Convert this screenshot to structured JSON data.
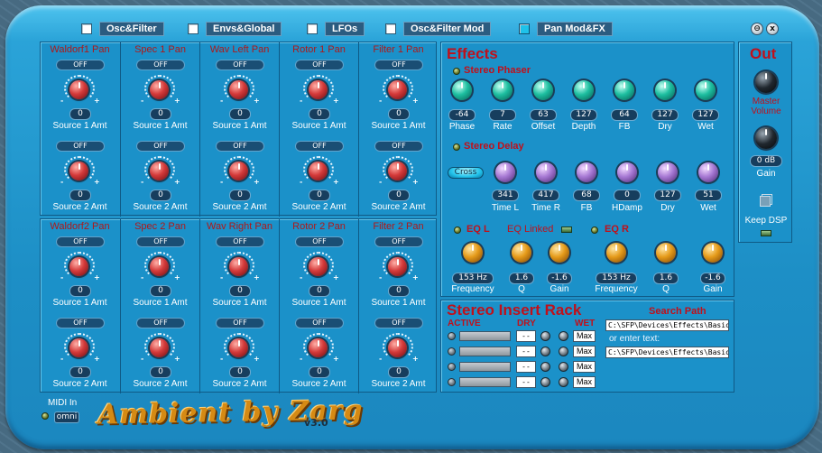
{
  "tabs": [
    {
      "label": "Osc&Filter",
      "active": false
    },
    {
      "label": "Envs&Global",
      "active": false
    },
    {
      "label": "LFOs",
      "active": false
    },
    {
      "label": "Osc&Filter Mod",
      "active": false
    },
    {
      "label": "Pan Mod&FX",
      "active": true
    }
  ],
  "window": {
    "minimize": "⊖",
    "close": "x"
  },
  "pan_rows": [
    {
      "cells": [
        {
          "title": "Waldorf1 Pan",
          "btn1": "OFF",
          "val1": "0",
          "lbl1": "Source 1 Amt",
          "btn2": "OFF",
          "val2": "0",
          "lbl2": "Source 2 Amt"
        },
        {
          "title": "Spec 1 Pan",
          "btn1": "OFF",
          "val1": "0",
          "lbl1": "Source 1 Amt",
          "btn2": "OFF",
          "val2": "0",
          "lbl2": "Source 2 Amt"
        },
        {
          "title": "Wav Left Pan",
          "btn1": "OFF",
          "val1": "0",
          "lbl1": "Source 1 Amt",
          "btn2": "OFF",
          "val2": "0",
          "lbl2": "Source 2 Amt"
        },
        {
          "title": "Rotor 1 Pan",
          "btn1": "OFF",
          "val1": "0",
          "lbl1": "Source 1 Amt",
          "btn2": "OFF",
          "val2": "0",
          "lbl2": "Source 2 Amt"
        },
        {
          "title": "Filter 1 Pan",
          "btn1": "OFF",
          "val1": "0",
          "lbl1": "Source 1 Amt",
          "btn2": "OFF",
          "val2": "0",
          "lbl2": "Source 2 Amt"
        }
      ]
    },
    {
      "cells": [
        {
          "title": "Waldorf2 Pan",
          "btn1": "OFF",
          "val1": "0",
          "lbl1": "Source 1 Amt",
          "btn2": "OFF",
          "val2": "0",
          "lbl2": "Source 2 Amt"
        },
        {
          "title": "Spec 2 Pan",
          "btn1": "OFF",
          "val1": "0",
          "lbl1": "Source 1 Amt",
          "btn2": "OFF",
          "val2": "0",
          "lbl2": "Source 2 Amt"
        },
        {
          "title": "Wav Right Pan",
          "btn1": "OFF",
          "val1": "0",
          "lbl1": "Source 1 Amt",
          "btn2": "OFF",
          "val2": "0",
          "lbl2": "Source 2 Amt"
        },
        {
          "title": "Rotor 2 Pan",
          "btn1": "OFF",
          "val1": "0",
          "lbl1": "Source 1 Amt",
          "btn2": "OFF",
          "val2": "0",
          "lbl2": "Source 2 Amt"
        },
        {
          "title": "Filter 2 Pan",
          "btn1": "OFF",
          "val1": "0",
          "lbl1": "Source 1 Amt",
          "btn2": "OFF",
          "val2": "0",
          "lbl2": "Source 2 Amt"
        }
      ]
    }
  ],
  "knob_marks": {
    "minus": "-",
    "plus": "+"
  },
  "effects": {
    "title": "Effects",
    "phaser": {
      "title": "Stereo Phaser",
      "params": [
        {
          "label": "Phase",
          "value": "-64"
        },
        {
          "label": "Rate",
          "value": "7"
        },
        {
          "label": "Offset",
          "value": "63"
        },
        {
          "label": "Depth",
          "value": "127"
        },
        {
          "label": "FB",
          "value": "64"
        },
        {
          "label": "Dry",
          "value": "127"
        },
        {
          "label": "Wet",
          "value": "127"
        }
      ]
    },
    "delay": {
      "title": "Stereo Delay",
      "cross": "Cross",
      "params": [
        {
          "label": "Time L",
          "value": "341"
        },
        {
          "label": "Time R",
          "value": "417"
        },
        {
          "label": "FB",
          "value": "68"
        },
        {
          "label": "HDamp",
          "value": "0"
        },
        {
          "label": "Dry",
          "value": "127"
        },
        {
          "label": "Wet",
          "value": "51"
        }
      ]
    },
    "eq": {
      "left_title": "EQ L",
      "linked": "EQ Linked",
      "right_title": "EQ R",
      "left": [
        {
          "label": "Frequency",
          "value": "153 Hz"
        },
        {
          "label": "Q",
          "value": "1.6"
        },
        {
          "label": "Gain",
          "value": "-1.6"
        }
      ],
      "right": [
        {
          "label": "Frequency",
          "value": "153 Hz"
        },
        {
          "label": "Q",
          "value": "1.6"
        },
        {
          "label": "Gain",
          "value": "-1.6"
        }
      ]
    }
  },
  "rack": {
    "title": "Stereo Insert Rack",
    "col_active": "ACTIVE",
    "col_dry": "DRY",
    "col_wet": "WET",
    "rows": [
      {
        "dry": "--",
        "wet": "Max"
      },
      {
        "dry": "--",
        "wet": "Max"
      },
      {
        "dry": "--",
        "wet": "Max"
      },
      {
        "dry": "--",
        "wet": "Max"
      }
    ],
    "search_title": "Search Path",
    "path1": "C:\\SFP\\Devices\\Effects\\Basic\\",
    "or_enter": "or enter text:",
    "path2": "C:\\SFP\\Devices\\Effects\\Basic\\"
  },
  "out": {
    "title": "Out",
    "master_label": "Master Volume",
    "gain_value": "0 dB",
    "gain_label": "Gain",
    "keep_dsp": "Keep DSP"
  },
  "midi": {
    "label": "MIDI In",
    "value": "omni"
  },
  "brand": {
    "logo": "Ambient by Zarg",
    "version": "v3.0"
  }
}
